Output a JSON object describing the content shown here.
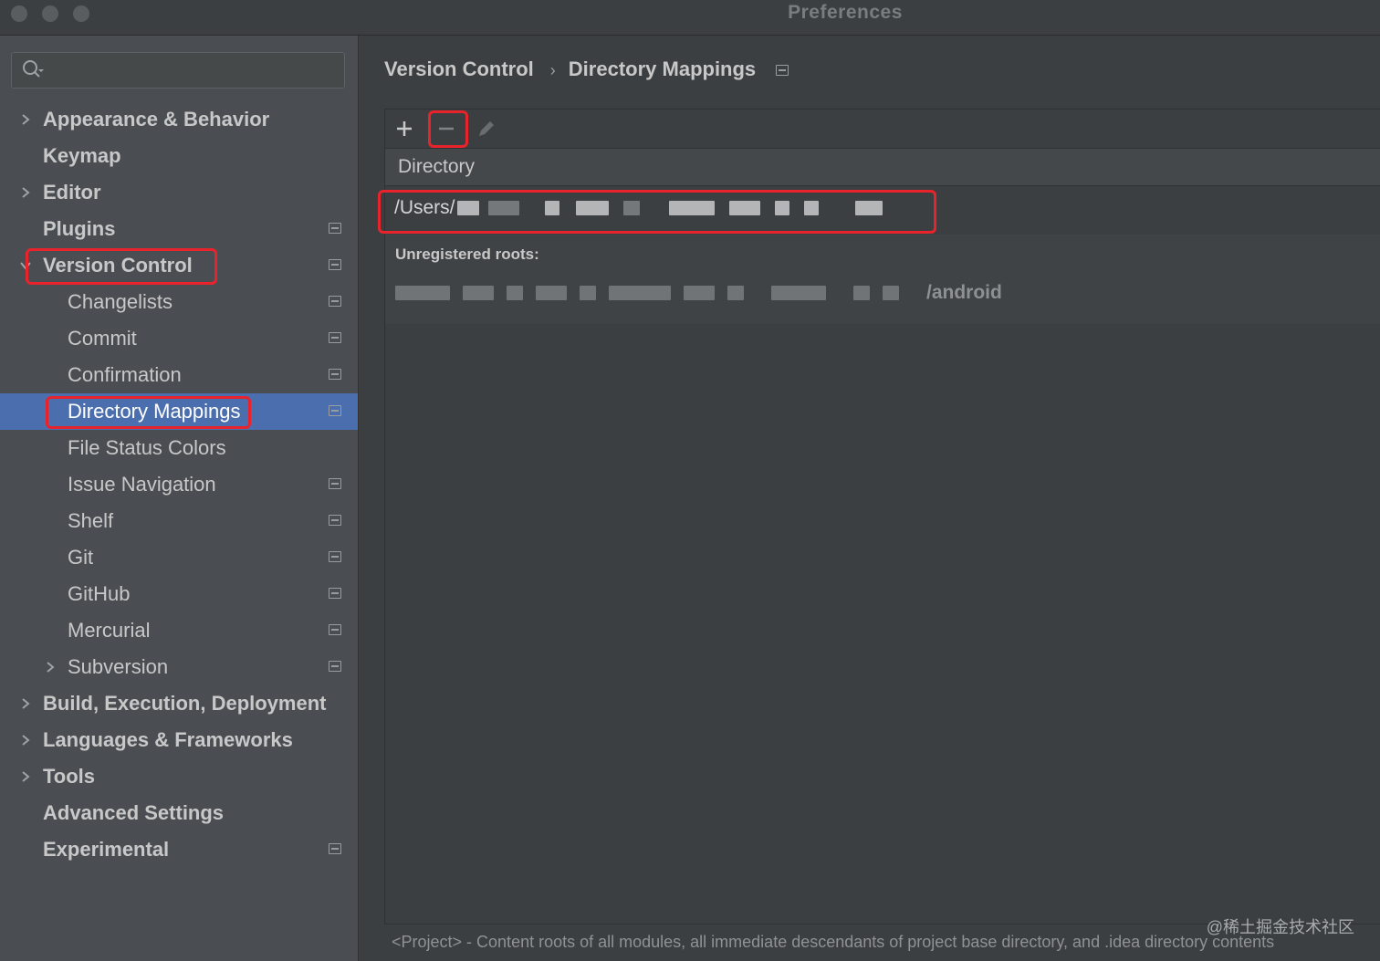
{
  "window": {
    "title": "Preferences"
  },
  "search": {
    "placeholder": ""
  },
  "sidebar": {
    "items": [
      {
        "label": "Appearance & Behavior"
      },
      {
        "label": "Keymap"
      },
      {
        "label": "Editor"
      },
      {
        "label": "Plugins"
      },
      {
        "label": "Version Control"
      },
      {
        "label": "Changelists"
      },
      {
        "label": "Commit"
      },
      {
        "label": "Confirmation"
      },
      {
        "label": "Directory Mappings"
      },
      {
        "label": "File Status Colors"
      },
      {
        "label": "Issue Navigation"
      },
      {
        "label": "Shelf"
      },
      {
        "label": "Git"
      },
      {
        "label": "GitHub"
      },
      {
        "label": "Mercurial"
      },
      {
        "label": "Subversion"
      },
      {
        "label": "Build, Execution, Deployment"
      },
      {
        "label": "Languages & Frameworks"
      },
      {
        "label": "Tools"
      },
      {
        "label": "Advanced Settings"
      },
      {
        "label": "Experimental"
      }
    ],
    "selected": "Directory Mappings"
  },
  "breadcrumb": {
    "parent": "Version Control",
    "separator": "›",
    "current": "Directory Mappings"
  },
  "toolbar": {
    "add_icon": "plus-icon",
    "remove_icon": "minus-icon",
    "edit_icon": "pencil-icon"
  },
  "table": {
    "column_header": "Directory",
    "mapping_path_prefix": "/Users/",
    "unregistered_title": "Unregistered roots:",
    "unregistered_suffix": "/android"
  },
  "footer": {
    "note": "<Project> - Content roots of all modules, all immediate descendants of project base directory, and .idea directory contents"
  },
  "watermark": "@稀土掘金技术社区",
  "colors": {
    "selection": "#4b6eaf",
    "highlight_box": "#e8232b",
    "sidebar_bg": "#4a4e53",
    "main_bg": "#3c3f41"
  }
}
